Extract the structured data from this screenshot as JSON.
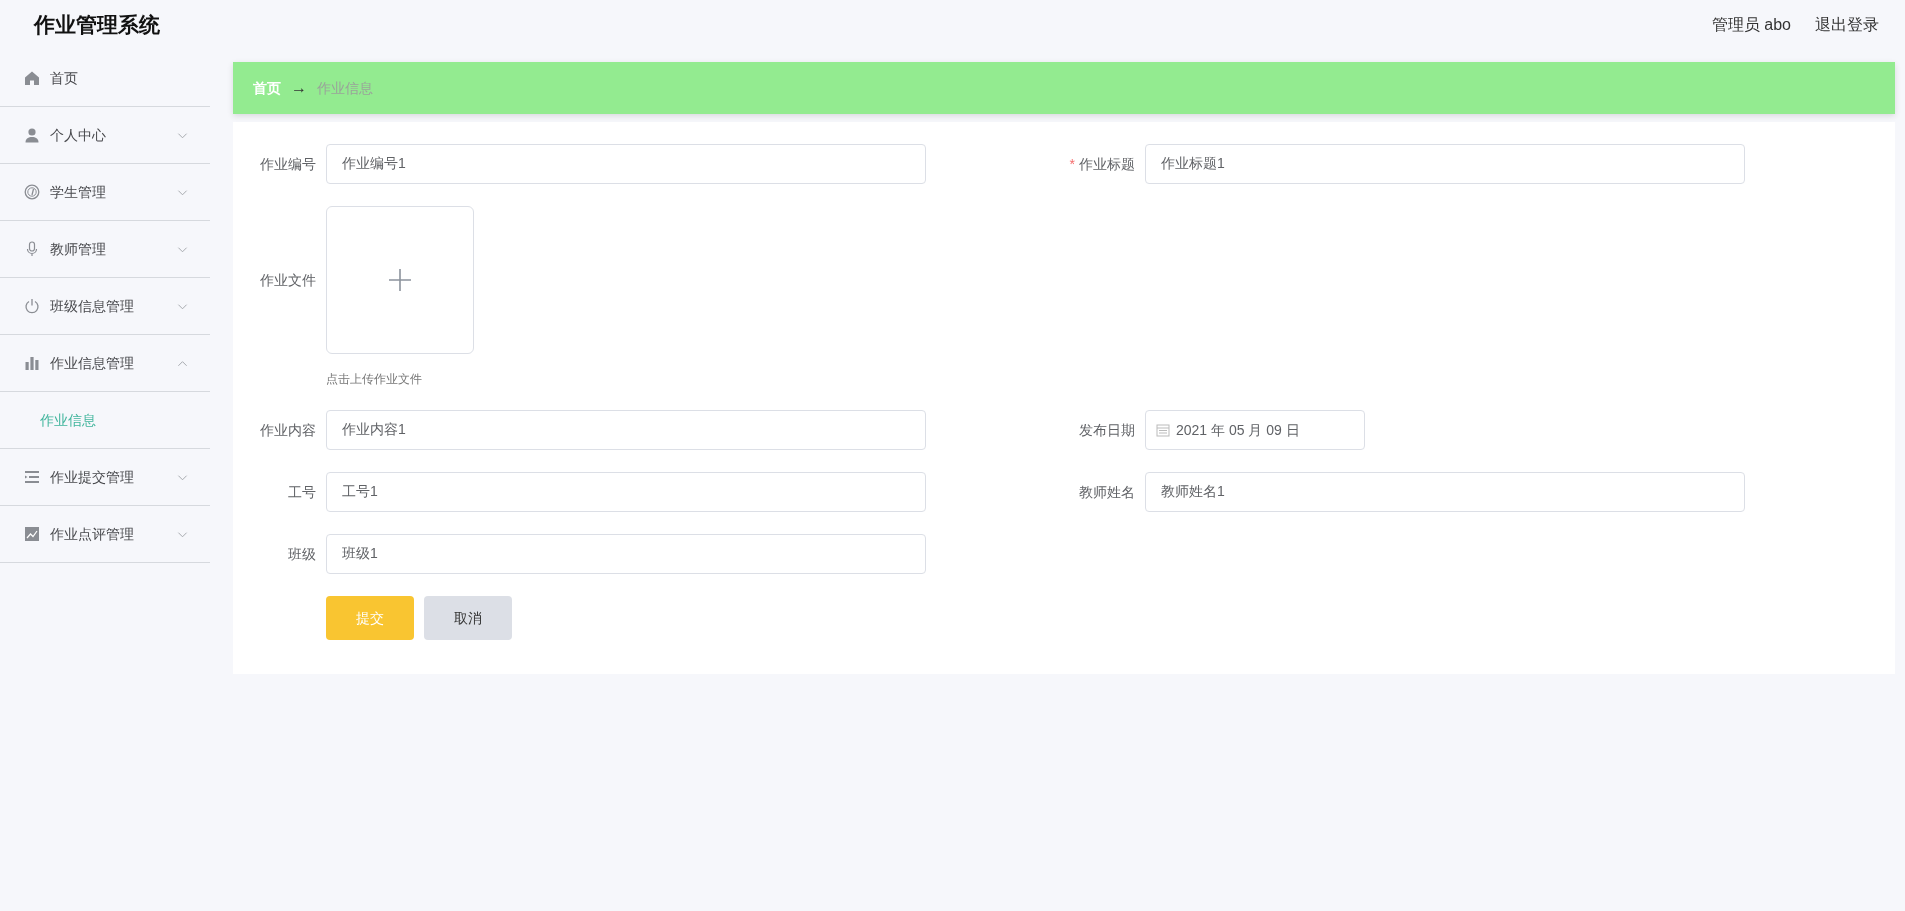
{
  "header": {
    "title": "作业管理系统",
    "user": "管理员 abo",
    "logout": "退出登录"
  },
  "sidebar": {
    "items": [
      {
        "label": "首页",
        "kind": "link"
      },
      {
        "label": "个人中心",
        "kind": "menu",
        "expanded": false
      },
      {
        "label": "学生管理",
        "kind": "menu",
        "expanded": false
      },
      {
        "label": "教师管理",
        "kind": "menu",
        "expanded": false
      },
      {
        "label": "班级信息管理",
        "kind": "menu",
        "expanded": false
      },
      {
        "label": "作业信息管理",
        "kind": "menu",
        "expanded": true,
        "children": [
          {
            "label": "作业信息",
            "selected": true
          }
        ]
      },
      {
        "label": "作业提交管理",
        "kind": "menu",
        "expanded": false
      },
      {
        "label": "作业点评管理",
        "kind": "menu",
        "expanded": false
      }
    ]
  },
  "breadcrumb": {
    "home": "首页",
    "separator": "→",
    "current": "作业信息"
  },
  "form": {
    "rows": [
      [
        {
          "label": "作业编号",
          "kind": "text",
          "value": "作业编号1"
        },
        {
          "label": "作业标题",
          "kind": "text",
          "value": "作业标题1",
          "required_mark": "*"
        }
      ],
      [
        {
          "label": "作业文件",
          "kind": "upload",
          "hint": "点击上传作业文件"
        }
      ],
      [
        {
          "label": "作业内容",
          "kind": "text",
          "value": "作业内容1"
        },
        {
          "label": "发布日期",
          "kind": "date",
          "value": "2021 年 05 月 09 日"
        }
      ],
      [
        {
          "label": "工号",
          "kind": "text",
          "value": "工号1"
        },
        {
          "label": "教师姓名",
          "kind": "text",
          "value": "教师姓名1"
        }
      ],
      [
        {
          "label": "班级",
          "kind": "text",
          "value": "班级1"
        }
      ]
    ],
    "buttons": [
      {
        "label": "提交",
        "kind": "primary"
      },
      {
        "label": "取消",
        "kind": "secondary"
      }
    ]
  }
}
